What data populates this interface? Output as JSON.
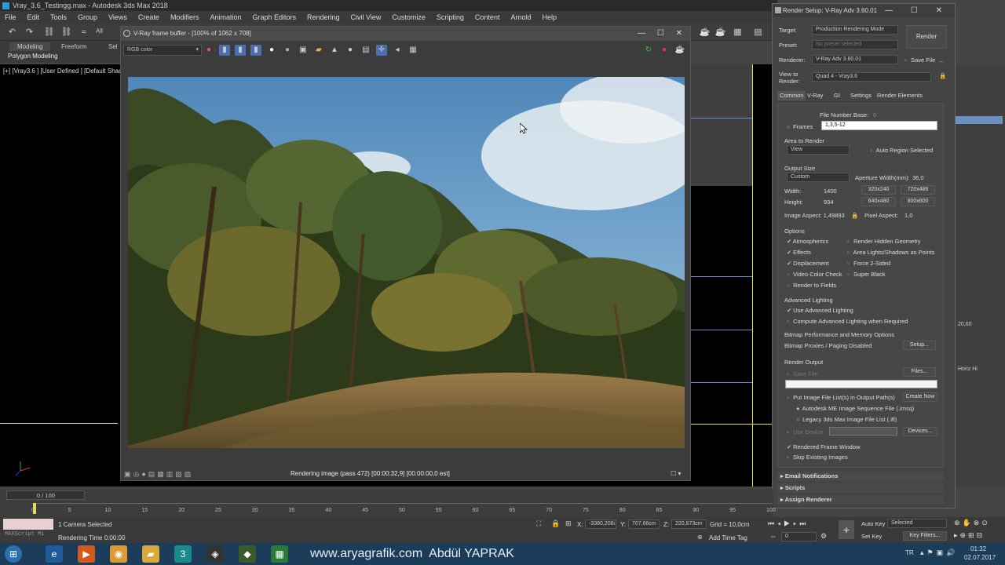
{
  "app": {
    "title": "Vray_3.6_Testingg.max - Autodesk 3ds Max 2018",
    "menu": [
      "File",
      "Edit",
      "Tools",
      "Group",
      "Views",
      "Create",
      "Modifiers",
      "Animation",
      "Graph Editors",
      "Rendering",
      "Civil View",
      "Customize",
      "Scripting",
      "Content",
      "Arnold",
      "Help"
    ],
    "toolbar_all": "All",
    "ribbon": {
      "tabs": [
        "Modeling",
        "Freeform",
        "Sel"
      ],
      "sub": "Polygon Modeling"
    },
    "viewport_label": "[+] [Vray3.6 ] [User Defined ] [Default Shad"
  },
  "vfb": {
    "title": "V-Ray frame buffer - [100% of 1062 x 708]",
    "channel": "RGB color",
    "status": "Rendering image (pass 472) [00:00:32,9] [00:00:00,0 est]",
    "controls": "— ☐ ✕"
  },
  "render_setup": {
    "title": "Render Setup: V-Ray Adv 3.60.01",
    "controls": "— ☐ ✕",
    "target_label": "Target:",
    "target_value": "Production Rendering Mode",
    "preset_label": "Preset:",
    "preset_value": "No preset selected",
    "renderer_label": "Renderer:",
    "renderer_value": "V-Ray Adv 3.60.01",
    "save_file": "Save File",
    "ellipsis": "...",
    "view_label_1": "View to",
    "view_label_2": "Render:",
    "view_value": "Quad 4 - Vray3.6",
    "render_button": "Render",
    "tabs": [
      "Common",
      "V-Ray",
      "GI",
      "Settings",
      "Render Elements"
    ],
    "file_number_base": "File Number Base:",
    "file_number_value": "0",
    "frames_label": "Frames",
    "frames_value": "1,3,5-12",
    "area_to_render": "Area to Render",
    "area_value": "View",
    "auto_region": "Auto Region Selected",
    "output_size": "Output Size",
    "size_preset": "Custom",
    "aperture_label": "Aperture Width(mm):",
    "aperture_value": "36,0",
    "width_label": "Width:",
    "width_value": "1400",
    "height_label": "Height:",
    "height_value": "934",
    "preset_sizes": [
      "320x240",
      "720x486",
      "640x480",
      "800x600"
    ],
    "image_aspect": "Image Aspect: 1,49893",
    "pixel_aspect_label": "Pixel Aspect:",
    "pixel_aspect_value": "1,0",
    "options": "Options",
    "opt_left": [
      "Atmospherics",
      "Effects",
      "Displacement",
      "Video Color Check",
      "Render to Fields"
    ],
    "opt_left_checked": [
      true,
      true,
      true,
      false,
      false
    ],
    "opt_right": [
      "Render Hidden Geometry",
      "Area Lights/Shadows as Points",
      "Force 2-Sided",
      "Super Black"
    ],
    "advanced_lighting": "Advanced Lighting",
    "use_adv_lighting": "Use Advanced Lighting",
    "compute_adv": "Compute Advanced Lighting when Required",
    "bitmap_perf": "Bitmap Performance and Memory Options",
    "bitmap_proxies": "Bitmap Proxies / Paging Disabled",
    "setup_button": "Setup...",
    "render_output": "Render Output",
    "save_file2": "Save File",
    "files_button": "Files...",
    "put_image": "Put Image File List(s) in Output Path(s)",
    "create_now": "Create Now",
    "autodesk_me": "Autodesk ME Image Sequence File (.imsq)",
    "legacy": "Legacy 3ds Max Image File List (.ifl)",
    "use_device": "Use Device",
    "devices_button": "Devices...",
    "rendered_frame_window": "Rendered Frame Window",
    "skip_existing": "Skip Existing Images",
    "rollouts": [
      "Email Notifications",
      "Scripts",
      "Assign Renderer"
    ]
  },
  "right_panel": {
    "value_1": "20,60",
    "label_1": "Horiz Hi"
  },
  "timeline": {
    "frame_counter": "0 / 100",
    "ticks": [
      "0",
      "5",
      "10",
      "15",
      "20",
      "25",
      "30",
      "35",
      "40",
      "45",
      "50",
      "55",
      "60",
      "65",
      "70",
      "75",
      "80",
      "85",
      "90",
      "95",
      "100"
    ]
  },
  "status": {
    "maxscript": "MAXScript Mi",
    "selection": "1 Camera Selected",
    "render_time": "Rendering Time 0:00:00",
    "x_label": "X:",
    "x_value": "-3380,206i",
    "y_label": "Y:",
    "y_value": "707,66cm",
    "z_label": "Z:",
    "z_value": "220,673cm",
    "grid": "Grid = 10,0cm",
    "add_time_tag": "Add Time Tag",
    "auto_key": "Auto Key",
    "selected": "Selected",
    "set_key": "Set Key",
    "key_filters": "Key Filters...",
    "frame_value": "0"
  },
  "taskbar": {
    "watermark": "www.aryagrafik.com  Abdül YAPRAK",
    "lang": "TR",
    "time": "01:32",
    "date": "02.07.2017"
  }
}
